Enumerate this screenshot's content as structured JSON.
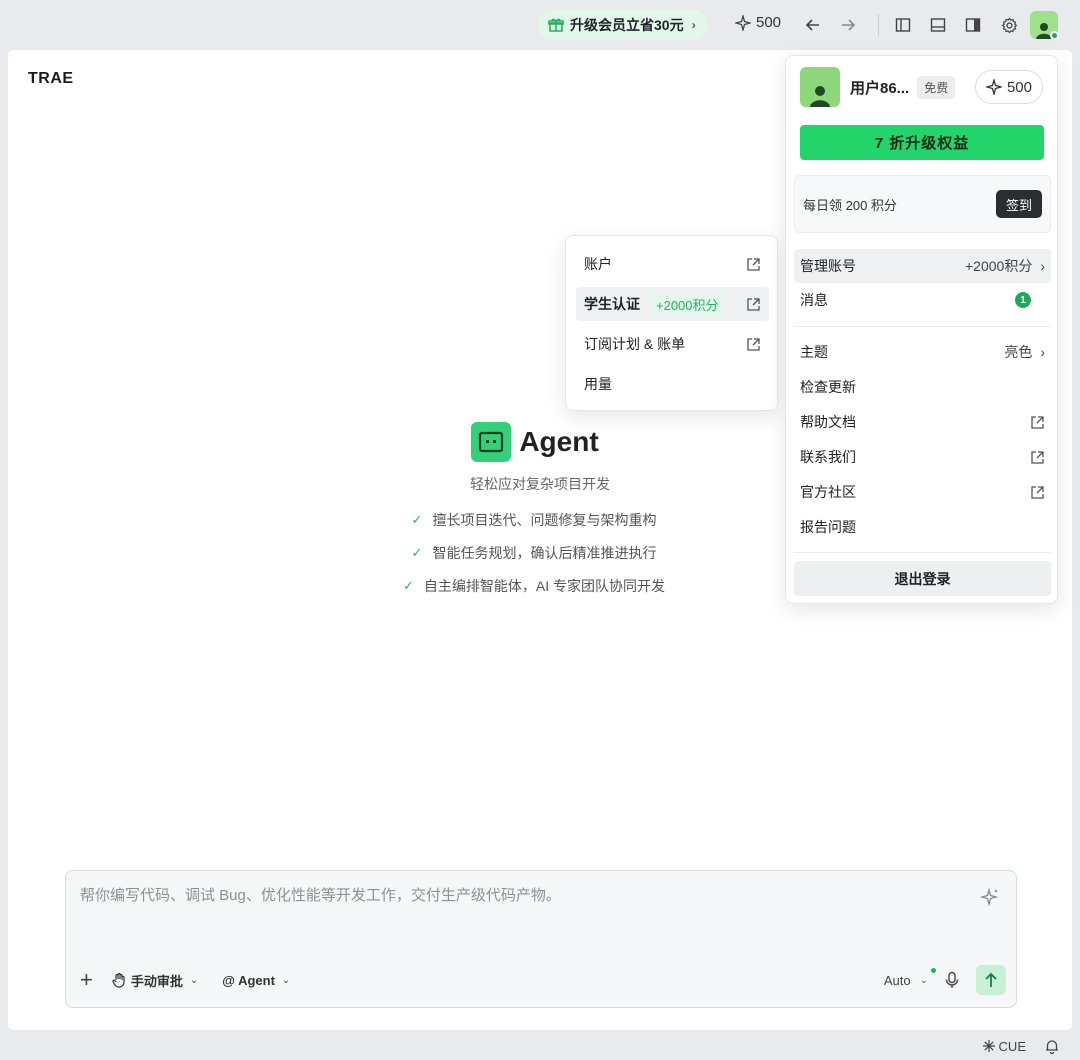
{
  "topbar": {
    "upgrade_label": "升级会员立省30元",
    "credits": "500",
    "icons": [
      "back-icon",
      "forward-icon",
      "sidebar-left-icon",
      "panel-bottom-icon",
      "sidebar-right-icon",
      "gear-icon",
      "avatar"
    ]
  },
  "brand": "TRAE",
  "hero": {
    "title": "Agent",
    "subtitle": "轻松应对复杂项目开发",
    "features": [
      "擅长项目迭代、问题修复与架构重构",
      "智能任务规划，确认后精准推进执行",
      "自主编排智能体，AI 专家团队协同开发"
    ]
  },
  "composer": {
    "placeholder": "帮你编写代码、调试 Bug、优化性能等开发工作，交付生产级代码产物。",
    "value": "",
    "manual_review_label": "手动审批",
    "agent_label": "@ Agent",
    "model_label": "Auto"
  },
  "statusbar": {
    "cue_label": "CUE"
  },
  "account_menu": {
    "username": "用户86...",
    "plan_badge": "免费",
    "credits": "500",
    "upgrade_label": "7 折升级权益",
    "daily_text": "每日领 200 积分",
    "checkin_label": "签到",
    "items": [
      {
        "label": "管理账号",
        "value": "+2000积分"
      },
      {
        "label": "消息",
        "badge": "1"
      },
      {
        "label": "主题",
        "value": "亮色"
      },
      {
        "label": "检查更新"
      },
      {
        "label": "帮助文档"
      },
      {
        "label": "联系我们"
      },
      {
        "label": "官方社区"
      },
      {
        "label": "报告问题"
      }
    ],
    "logout_label": "退出登录"
  },
  "submenu": {
    "items": [
      {
        "label": "账户"
      },
      {
        "label": "学生认证",
        "tag": "+2000积分"
      },
      {
        "label": "订阅计划 & 账单"
      },
      {
        "label": "用量"
      }
    ]
  },
  "colors": {
    "accent_green": "#22d46a",
    "brand_green": "#34cf79",
    "background": "#e9eaed"
  }
}
